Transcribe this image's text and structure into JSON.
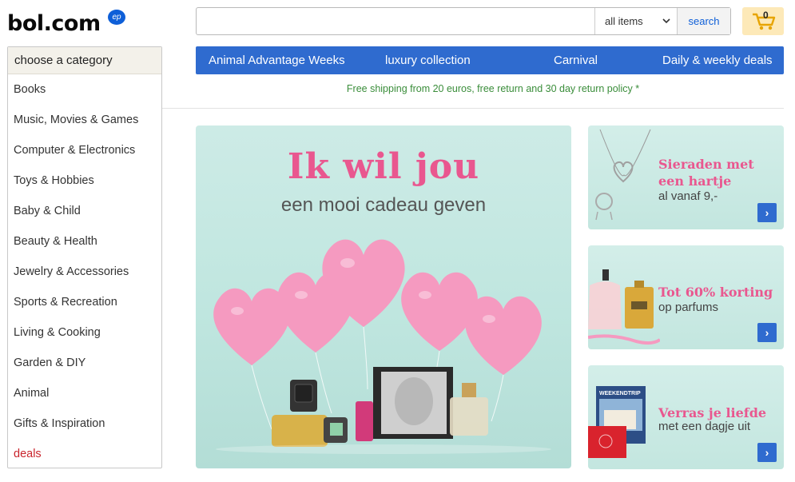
{
  "logo": {
    "text": "bol.com",
    "badge": "ep"
  },
  "search": {
    "placeholder": "",
    "category_selected": "all items",
    "button_label": "search"
  },
  "cart": {
    "count": "0"
  },
  "sidebar": {
    "title": "choose a category",
    "items": [
      {
        "label": "Books"
      },
      {
        "label": "Music, Movies & Games"
      },
      {
        "label": "Computer & Electronics"
      },
      {
        "label": "Toys & Hobbies"
      },
      {
        "label": "Baby & Child"
      },
      {
        "label": "Beauty & Health"
      },
      {
        "label": "Jewelry & Accessories"
      },
      {
        "label": "Sports & Recreation"
      },
      {
        "label": "Living & Cooking"
      },
      {
        "label": "Garden & DIY"
      },
      {
        "label": "Animal"
      },
      {
        "label": "Gifts & Inspiration"
      },
      {
        "label": "deals"
      }
    ]
  },
  "nav": {
    "items": [
      {
        "label": "Animal Advantage Weeks"
      },
      {
        "label": "luxury collection"
      },
      {
        "label": "Carnival"
      },
      {
        "label": "Daily & weekly deals"
      }
    ]
  },
  "shipping_note": "Free shipping from 20 euros, free return and 30 day return policy *",
  "hero": {
    "title": "Ik wil jou",
    "subtitle": "een mooi cadeau geven"
  },
  "promos": [
    {
      "title_line1": "Sieraden met",
      "title_line2": "een hartje",
      "subtitle": "al vanaf 9,-"
    },
    {
      "title_line1": "Tot 60% korting",
      "title_line2": "",
      "subtitle": "op parfums"
    },
    {
      "title_line1": "Verras je liefde",
      "title_line2": "",
      "subtitle": "met een dagje uit",
      "tag": "WEEKENDTRIP"
    }
  ],
  "colors": {
    "brand_blue": "#2f6bcf",
    "pink": "#e9578f",
    "shipping_green": "#3a8d3a",
    "deal_red": "#c9242c",
    "cart_bg": "#fde9b8"
  },
  "icons": {
    "cart": "shopping-cart-icon",
    "dropdown": "chevron-down-icon",
    "promo_arrow": "chevron-right-icon"
  }
}
